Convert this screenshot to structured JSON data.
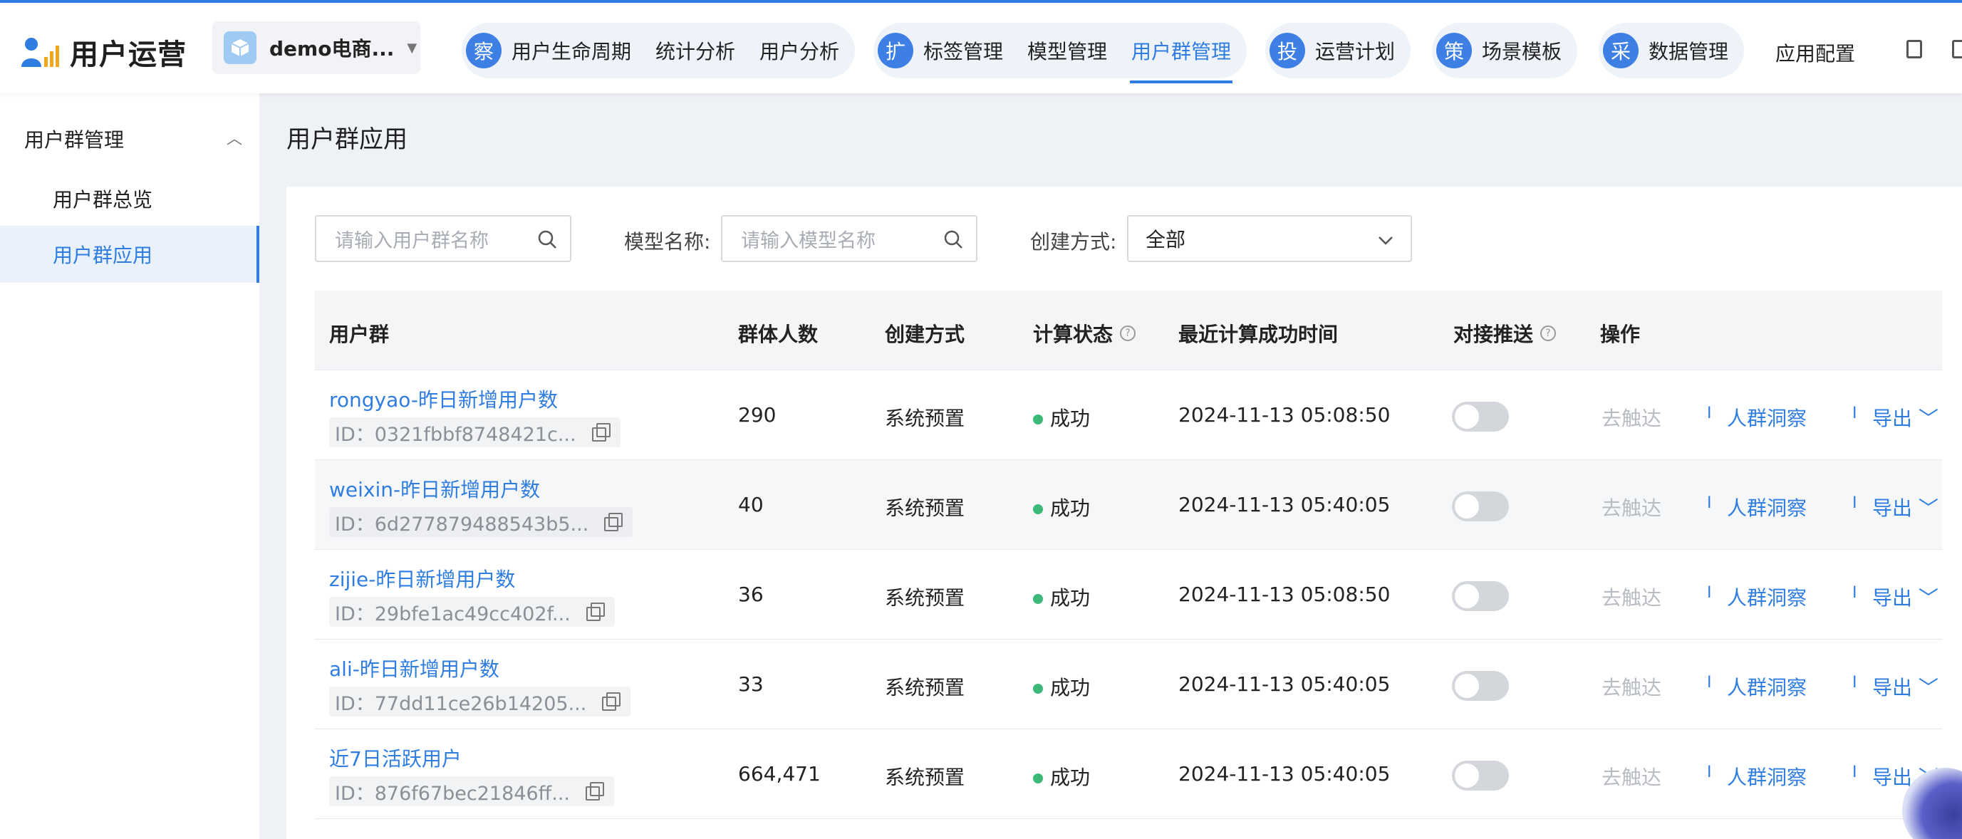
{
  "app": {
    "title": "用户运营"
  },
  "project": {
    "name": "demo电商..."
  },
  "nav": {
    "groups": [
      {
        "badge": "察",
        "items": [
          "用户生命周期",
          "统计分析",
          "用户分析"
        ]
      },
      {
        "badge": "扩",
        "items": [
          "标签管理",
          "模型管理",
          "用户群管理"
        ]
      },
      {
        "badge": "投",
        "items": [
          "运营计划"
        ]
      },
      {
        "badge": "策",
        "items": [
          "场景模板"
        ]
      },
      {
        "badge": "采",
        "items": [
          "数据管理"
        ]
      }
    ],
    "app_config": "应用配置",
    "active": "用户群管理"
  },
  "sidebar": {
    "group": "用户群管理",
    "items": [
      "用户群总览",
      "用户群应用"
    ],
    "active": "用户群应用"
  },
  "page": {
    "title": "用户群应用"
  },
  "filters": {
    "group_placeholder": "请输入用户群名称",
    "model_label": "模型名称:",
    "model_placeholder": "请输入模型名称",
    "method_label": "创建方式:",
    "method_value": "全部"
  },
  "table": {
    "headers": [
      "用户群",
      "群体人数",
      "创建方式",
      "计算状态",
      "最近计算成功时间",
      "对接推送",
      "操作"
    ],
    "rows": [
      {
        "name": "rongyao-昨日新增用户数",
        "id": "ID：0321fbbf8748421c...",
        "count": "290",
        "method": "系统预置",
        "status": "成功",
        "time": "2024-11-13 05:08:50",
        "push": false
      },
      {
        "name": "weixin-昨日新增用户数",
        "id": "ID：6d277879488543b5...",
        "count": "40",
        "method": "系统预置",
        "status": "成功",
        "time": "2024-11-13 05:40:05",
        "push": false
      },
      {
        "name": "zijie-昨日新增用户数",
        "id": "ID：29bfe1ac49cc402f...",
        "count": "36",
        "method": "系统预置",
        "status": "成功",
        "time": "2024-11-13 05:08:50",
        "push": false
      },
      {
        "name": "ali-昨日新增用户数",
        "id": "ID：77dd11ce26b14205...",
        "count": "33",
        "method": "系统预置",
        "status": "成功",
        "time": "2024-11-13 05:40:05",
        "push": false
      },
      {
        "name": "近7日活跃用户",
        "id": "ID：876f67bec21846ff...",
        "count": "664,471",
        "method": "系统预置",
        "status": "成功",
        "time": "2024-11-13 05:40:05",
        "push": false
      }
    ],
    "actions": {
      "reach": "去触达",
      "insight": "人群洞察",
      "export": "导出"
    }
  },
  "colors": {
    "accent": "#2f7de1",
    "success": "#3cb878"
  }
}
